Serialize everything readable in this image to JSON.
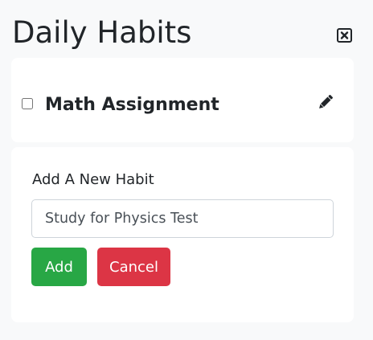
{
  "app": {
    "title": "Daily Habits",
    "close_icon": "close-square-icon"
  },
  "habits": [
    {
      "name": "Math Assignment",
      "checked": false,
      "edit_icon": "pencil-icon"
    }
  ],
  "form": {
    "label": "Add A New Habit",
    "input_value": "Study for Physics Test",
    "add_label": "Add",
    "cancel_label": "Cancel"
  },
  "colors": {
    "background": "#f8f9fa",
    "card": "#ffffff",
    "add_button": "#28a745",
    "cancel_button": "#dc3545",
    "text": "#212529"
  }
}
